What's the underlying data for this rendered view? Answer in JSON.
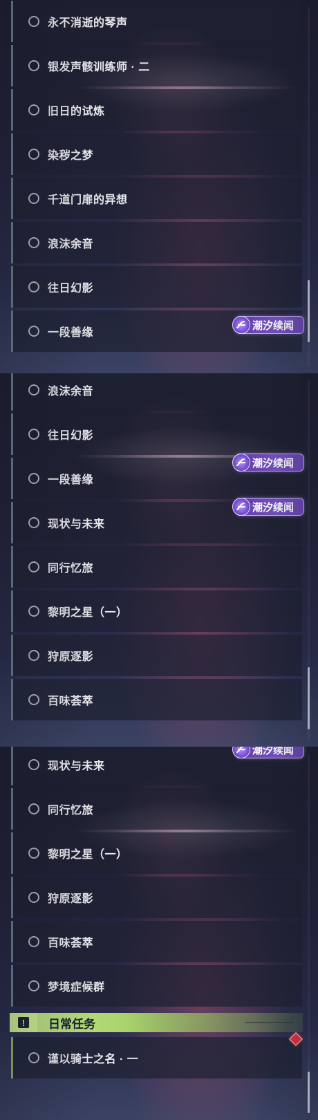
{
  "badge_label": "潮汐续闻",
  "icons": {
    "quest": "hollow-circle-icon",
    "badge": "tidal-spiral-icon",
    "section": "exclamation-icon",
    "alert": "red-diamond-icon"
  },
  "colors": {
    "row_bg": "#1e2132",
    "accent_bar": "#6e8090",
    "badge": "#6a47b3",
    "section": "#b9de78",
    "alert": "#e0303c"
  },
  "panels": [
    {
      "items": [
        {
          "label": "永不消逝的琴声"
        },
        {
          "label": "银发声骸训练师 · 二"
        },
        {
          "label": "旧日的试炼"
        },
        {
          "label": "染秽之梦"
        },
        {
          "label": "千道门扉的异想"
        },
        {
          "label": "浪沫余音"
        },
        {
          "label": "往日幻影"
        },
        {
          "label": "一段善缘"
        }
      ]
    },
    {
      "items": [
        {
          "label": "浪沫余音"
        },
        {
          "label": "往日幻影"
        },
        {
          "label": "一段善缘"
        },
        {
          "label": "现状与未来"
        },
        {
          "label": "同行忆旅"
        },
        {
          "label": "黎明之星（一）"
        },
        {
          "label": "狩原逐影"
        },
        {
          "label": "百味荟萃"
        }
      ]
    },
    {
      "items": [
        {
          "label": "现状与未来"
        },
        {
          "label": "同行忆旅"
        },
        {
          "label": "黎明之星（一）"
        },
        {
          "label": "狩原逐影"
        },
        {
          "label": "百味荟萃"
        },
        {
          "label": "梦境症候群"
        }
      ],
      "section": {
        "title": "日常任务",
        "icon_glyph": "!"
      },
      "daily_items": [
        {
          "label": "谨以骑士之名 · 一"
        }
      ]
    }
  ]
}
